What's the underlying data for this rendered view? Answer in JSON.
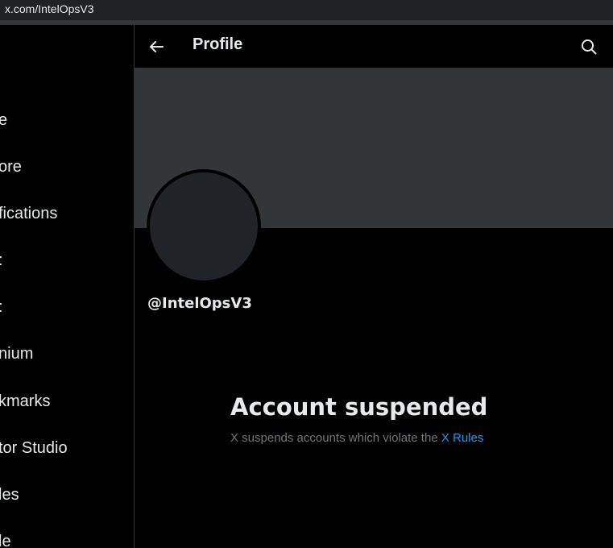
{
  "browser": {
    "url": "x.com/IntelOpsV3"
  },
  "sidebar": {
    "items": [
      {
        "label": "e"
      },
      {
        "label": "ore"
      },
      {
        "label": "fications"
      },
      {
        "label": ":"
      },
      {
        "label": ":"
      },
      {
        "label": "nium"
      },
      {
        "label": "kmarks"
      },
      {
        "label": "tor Studio"
      },
      {
        "label": "les"
      },
      {
        "label": "le"
      }
    ]
  },
  "header": {
    "title": "Profile",
    "back_icon": "arrow-left-icon",
    "search_icon": "search-icon"
  },
  "profile": {
    "handle": "@IntelOpsV3",
    "banner_color": "#333639",
    "avatar_color": "#202327"
  },
  "suspension": {
    "title": "Account suspended",
    "message": "X suspends accounts which violate the ",
    "link_text": "X Rules",
    "link_color": "#1d9bf0"
  }
}
